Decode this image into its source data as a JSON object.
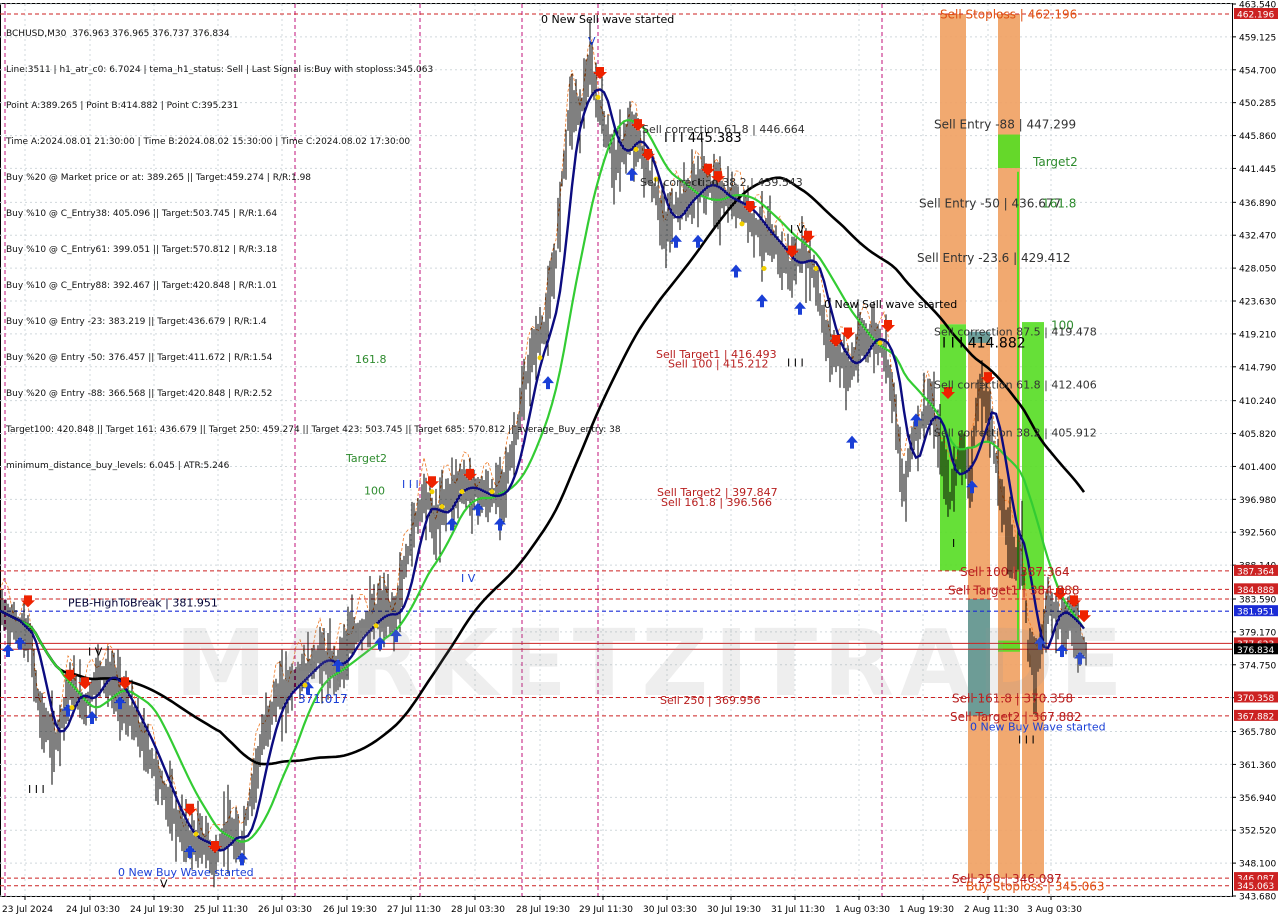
{
  "header": {
    "symbol_line": "BCHUSD,M30  376.963 376.965 376.737 376.834",
    "info_lines": [
      "Line:3511 | h1_atr_c0: 6.7024 | tema_h1_status: Sell | Last Signal is:Buy with stoploss:345.063",
      "Point A:389.265 | Point B:414.882 | Point C:395.231",
      "Time A:2024.08.01 21:30:00 | Time B:2024.08.02 15:30:00 | Time C:2024.08.02 17:30:00",
      "Buy %20 @ Market price or at: 389.265 || Target:459.274 | R/R:1.98",
      "Buy %10 @ C_Entry38: 405.096 || Target:503.745 | R/R:1.64",
      "Buy %10 @ C_Entry61: 399.051 || Target:570.812 | R/R:3.18",
      "Buy %10 @ C_Entry88: 392.467 || Target:420.848 | R/R:1.01",
      "Buy %10 @ Entry -23: 383.219 || Target:436.679 | R/R:1.4",
      "Buy %20 @ Entry -50: 376.457 || Target:411.672 | R/R:1.54",
      "Buy %20 @ Entry -88: 366.568 || Target:420.848 | R/R:2.52",
      "Target100: 420.848 || Target 161: 436.679 || Target 250: 459.274 || Target 423: 503.745 || Target 685: 570.812 || average_Buy_entry: 38",
      "minimum_distance_buy_levels: 6.045 | ATR:5.246"
    ]
  },
  "watermark": "MARKETZITRADE",
  "colors": {
    "bg": "#ffffff",
    "grid": "#d0d8dc",
    "magenta_vline": "#c0107a",
    "candle": "#000000",
    "green_ma": "#33cc33",
    "navy_ma": "#0c0c80",
    "black_ma": "#000000",
    "red_level": "#cc2222",
    "blue_level": "#1a2bd6",
    "sell_arrow": "#ee2200",
    "buy_arrow": "#1a3fd6",
    "zone_orange": "#f0a060",
    "zone_green": "#55dd22",
    "zone_teal": "#5e9a9a",
    "price_label": "#cc2222",
    "current_price_bg": "#000000"
  },
  "chart_data": {
    "type": "candlestick",
    "symbol": "BCHUSD",
    "timeframe": "M30",
    "grid": true,
    "ylim": [
      343.68,
      463.54
    ],
    "y_ticks": [
      "463.540",
      "459.125",
      "454.700",
      "450.285",
      "445.860",
      "441.445",
      "436.890",
      "432.470",
      "428.050",
      "423.630",
      "419.210",
      "414.790",
      "410.240",
      "405.820",
      "401.400",
      "396.980",
      "392.560",
      "388.140",
      "383.590",
      "379.170",
      "374.750",
      "370.330",
      "365.780",
      "361.360",
      "356.940",
      "352.520",
      "348.100",
      "343.680"
    ],
    "x_labels": [
      "23 Jul 2024",
      "24 Jul 03:30",
      "24 Jul 19:30",
      "25 Jul 11:30",
      "26 Jul 03:30",
      "26 Jul 19:30",
      "27 Jul 11:30",
      "28 Jul 03:30",
      "28 Jul 19:30",
      "29 Jul 11:30",
      "30 Jul 03:30",
      "30 Jul 19:30",
      "31 Jul 11:30",
      "1 Aug 03:30",
      "1 Aug 19:30",
      "2 Aug 11:30",
      "3 Aug 03:30"
    ],
    "price_path": [
      [
        0,
        382
      ],
      [
        15,
        380
      ],
      [
        30,
        378
      ],
      [
        40,
        368
      ],
      [
        55,
        364
      ],
      [
        70,
        372
      ],
      [
        85,
        369
      ],
      [
        100,
        374
      ],
      [
        115,
        372
      ],
      [
        130,
        368
      ],
      [
        145,
        364
      ],
      [
        160,
        359
      ],
      [
        175,
        354
      ],
      [
        190,
        351
      ],
      [
        205,
        351
      ],
      [
        215,
        348
      ],
      [
        225,
        353
      ],
      [
        240,
        350
      ],
      [
        255,
        360
      ],
      [
        265,
        366
      ],
      [
        275,
        370
      ],
      [
        290,
        372
      ],
      [
        305,
        374
      ],
      [
        320,
        376
      ],
      [
        335,
        374
      ],
      [
        350,
        378
      ],
      [
        365,
        380
      ],
      [
        380,
        382
      ],
      [
        395,
        381
      ],
      [
        405,
        388
      ],
      [
        415,
        394
      ],
      [
        425,
        398
      ],
      [
        435,
        393
      ],
      [
        445,
        397
      ],
      [
        460,
        399
      ],
      [
        475,
        398
      ],
      [
        490,
        397
      ],
      [
        505,
        399
      ],
      [
        515,
        405
      ],
      [
        525,
        412
      ],
      [
        535,
        418
      ],
      [
        545,
        420
      ],
      [
        555,
        428
      ],
      [
        562,
        440
      ],
      [
        570,
        450
      ],
      [
        580,
        449
      ],
      [
        590,
        455
      ],
      [
        598,
        450
      ],
      [
        605,
        447
      ],
      [
        615,
        442
      ],
      [
        625,
        445
      ],
      [
        635,
        446
      ],
      [
        645,
        442
      ],
      [
        655,
        438
      ],
      [
        665,
        433
      ],
      [
        675,
        436
      ],
      [
        690,
        438
      ],
      [
        705,
        440
      ],
      [
        715,
        438
      ],
      [
        730,
        437
      ],
      [
        745,
        436
      ],
      [
        760,
        433
      ],
      [
        775,
        431
      ],
      [
        790,
        428
      ],
      [
        805,
        430
      ],
      [
        815,
        427
      ],
      [
        825,
        419
      ],
      [
        840,
        416
      ],
      [
        850,
        414
      ],
      [
        860,
        418
      ],
      [
        875,
        419
      ],
      [
        885,
        417
      ],
      [
        895,
        410
      ],
      [
        903,
        397
      ],
      [
        910,
        404
      ],
      [
        920,
        407
      ],
      [
        930,
        410
      ],
      [
        940,
        404
      ],
      [
        950,
        397
      ],
      [
        960,
        404
      ],
      [
        970,
        400
      ],
      [
        980,
        412
      ],
      [
        990,
        408
      ],
      [
        998,
        400
      ],
      [
        1005,
        394
      ],
      [
        1015,
        389
      ],
      [
        1022,
        391
      ],
      [
        1028,
        377
      ],
      [
        1035,
        373
      ],
      [
        1042,
        379
      ],
      [
        1050,
        383
      ],
      [
        1060,
        381
      ],
      [
        1070,
        381
      ],
      [
        1080,
        378
      ],
      [
        1086,
        377
      ]
    ],
    "current_price": 376.834,
    "current_price_label": "376.834",
    "horizontal_levels": [
      {
        "price": 462.196,
        "label": "462.196",
        "color": "#cc2222",
        "style": "dash"
      },
      {
        "price": 387.364,
        "label": "387.364",
        "color": "#cc2222",
        "style": "dash"
      },
      {
        "price": 384.888,
        "label": "384.888",
        "color": "#cc2222",
        "style": "dash"
      },
      {
        "price": 383.59,
        "label": "",
        "color": "#cc2222",
        "style": "dash"
      },
      {
        "price": 381.951,
        "label": "381.951",
        "color": "#1a2bd6",
        "style": "dash"
      },
      {
        "price": 377.623,
        "label": "377.623",
        "color": "#cc2222",
        "style": "solid"
      },
      {
        "price": 376.834,
        "label": "",
        "color": "#cc2222",
        "style": "solid"
      },
      {
        "price": 370.358,
        "label": "370.358",
        "color": "#cc2222",
        "style": "dash"
      },
      {
        "price": 367.882,
        "label": "367.882",
        "color": "#cc2222",
        "style": "dash"
      },
      {
        "price": 346.087,
        "label": "346.087",
        "color": "#cc2222",
        "style": "dash"
      },
      {
        "price": 345.063,
        "label": "345.063",
        "color": "#cc2222",
        "style": "dash"
      }
    ],
    "annotations": [
      {
        "text": "0 New Sell wave started",
        "xi": 541,
        "price": 461.0,
        "color": "#000000"
      },
      {
        "text": "V",
        "xi": 588,
        "price": 458.0,
        "color": "#1a3fd6"
      },
      {
        "text": "I I I  445.383",
        "xi": 664,
        "price": 445.0,
        "color": "#000000",
        "size": 13
      },
      {
        "text": "Sell correction 61.8 | 446.664",
        "xi": 642,
        "price": 446.2,
        "color": "#333333"
      },
      {
        "text": "Sell correction 38.2 | 439.543",
        "xi": 640,
        "price": 439.1,
        "color": "#333333"
      },
      {
        "text": "I V",
        "xi": 790,
        "price": 432.8,
        "color": "#000000"
      },
      {
        "text": "0 New Sell wave started",
        "xi": 824,
        "price": 422.7,
        "color": "#000000"
      },
      {
        "text": "I I I",
        "xi": 787,
        "price": 414.8,
        "color": "#000000"
      },
      {
        "text": "161.8",
        "xi": 355,
        "price": 415.3,
        "color": "#2e8b2e"
      },
      {
        "text": "Target2",
        "xi": 346,
        "price": 402.0,
        "color": "#2e8b2e"
      },
      {
        "text": "100",
        "xi": 364,
        "price": 397.6,
        "color": "#2e8b2e"
      },
      {
        "text": "I I I",
        "xi": 402,
        "price": 398.5,
        "color": "#1a3fd6"
      },
      {
        "text": "I V",
        "xi": 461,
        "price": 385.9,
        "color": "#1a3fd6"
      },
      {
        "text": "Sell Target1 | 416.493",
        "xi": 656,
        "price": 416.0,
        "color": "#b82020"
      },
      {
        "text": "Sell 100 | 415.212",
        "xi": 668,
        "price": 414.7,
        "color": "#b82020"
      },
      {
        "text": "Sell Target2 | 397.847",
        "xi": 657,
        "price": 397.4,
        "color": "#b82020"
      },
      {
        "text": "Sell 161.8 | 396.566",
        "xi": 661,
        "price": 396.1,
        "color": "#b82020"
      },
      {
        "text": "PEB-HighToBreak | 381.951",
        "xi": 68,
        "price": 382.6,
        "color": "#000033"
      },
      {
        "text": "I V",
        "xi": 88,
        "price": 376.0,
        "color": "#000000"
      },
      {
        "text": "I I I",
        "xi": 28,
        "price": 357.5,
        "color": "#000000"
      },
      {
        "text": "371.017",
        "xi": 298,
        "price": 369.6,
        "color": "#1a3fd6",
        "size": 12
      },
      {
        "text": "Sell 250 | 369.956",
        "xi": 660,
        "price": 369.5,
        "color": "#b82020"
      },
      {
        "text": "0 New Buy Wave started",
        "xi": 118,
        "price": 346.4,
        "color": "#1a3fd6"
      },
      {
        "text": "V",
        "xi": 160,
        "price": 344.8,
        "color": "#000000"
      },
      {
        "text": "Sell Stoploss | 462.196",
        "xi": 940,
        "price": 461.6,
        "color": "#e05010",
        "size": 12
      },
      {
        "text": "Sell Entry -88 | 447.299",
        "xi": 934,
        "price": 446.8,
        "color": "#333333",
        "size": 12
      },
      {
        "text": "Target2",
        "xi": 1033,
        "price": 441.8,
        "color": "#2e8b2e",
        "size": 12
      },
      {
        "text": "Sell Entry -50 | 436.677",
        "xi": 919,
        "price": 436.2,
        "color": "#333333",
        "size": 12
      },
      {
        "text": "161.8",
        "xi": 1042,
        "price": 436.2,
        "color": "#2e8b2e",
        "size": 12
      },
      {
        "text": "Sell Entry -23.6 | 429.412",
        "xi": 917,
        "price": 428.9,
        "color": "#333333",
        "size": 12
      },
      {
        "text": "100",
        "xi": 1051,
        "price": 419.8,
        "color": "#2e8b2e",
        "size": 12
      },
      {
        "text": "Sell correction 87.5 | 419.478",
        "xi": 934,
        "price": 419.0,
        "color": "#333333"
      },
      {
        "text": "I I I   414.882",
        "xi": 942,
        "price": 417.4,
        "color": "#000000",
        "size": 14
      },
      {
        "text": "Sell correction 61.8 | 412.406",
        "xi": 934,
        "price": 411.9,
        "color": "#333333"
      },
      {
        "text": "Sell correction 38.2 | 405.912",
        "xi": 934,
        "price": 405.4,
        "color": "#333333"
      },
      {
        "text": "I",
        "xi": 952,
        "price": 390.6,
        "color": "#000000"
      },
      {
        "text": "Sell 100 | 387.364",
        "xi": 960,
        "price": 386.7,
        "color": "#b82020",
        "size": 12
      },
      {
        "text": "Sell Target1 | 384.888",
        "xi": 948,
        "price": 384.2,
        "color": "#b82020",
        "size": 12
      },
      {
        "text": "Sell 161.8 | 370.358",
        "xi": 952,
        "price": 369.7,
        "color": "#b82020",
        "size": 12
      },
      {
        "text": "Sell Target2 | 367.882",
        "xi": 950,
        "price": 367.2,
        "color": "#b82020",
        "size": 12
      },
      {
        "text": "0 New Buy Wave started",
        "xi": 970,
        "price": 365.9,
        "color": "#1a3fd6"
      },
      {
        "text": "I I I",
        "xi": 1018,
        "price": 364.2,
        "color": "#000000"
      },
      {
        "text": "Sell 250 | 346.087",
        "xi": 952,
        "price": 345.4,
        "color": "#b82020",
        "size": 12
      },
      {
        "text": "Buy Stoploss | 345.063",
        "xi": 966,
        "price": 344.4,
        "color": "#e05010",
        "size": 12
      }
    ]
  }
}
